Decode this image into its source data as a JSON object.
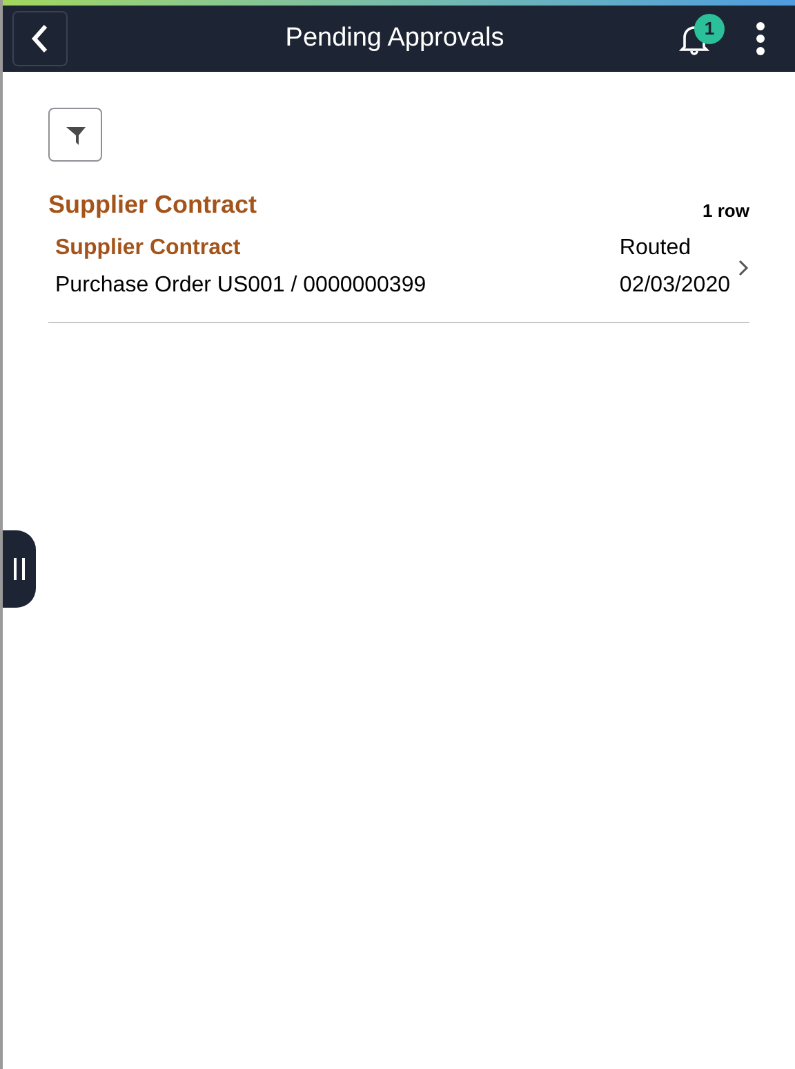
{
  "header": {
    "title": "Pending Approvals",
    "notification_count": "1"
  },
  "section": {
    "title": "Supplier Contract",
    "row_count": "1 row"
  },
  "rows": [
    {
      "title": "Supplier Contract",
      "description": "Purchase Order US001 / 0000000399",
      "status": "Routed",
      "date": "02/03/2020"
    }
  ]
}
